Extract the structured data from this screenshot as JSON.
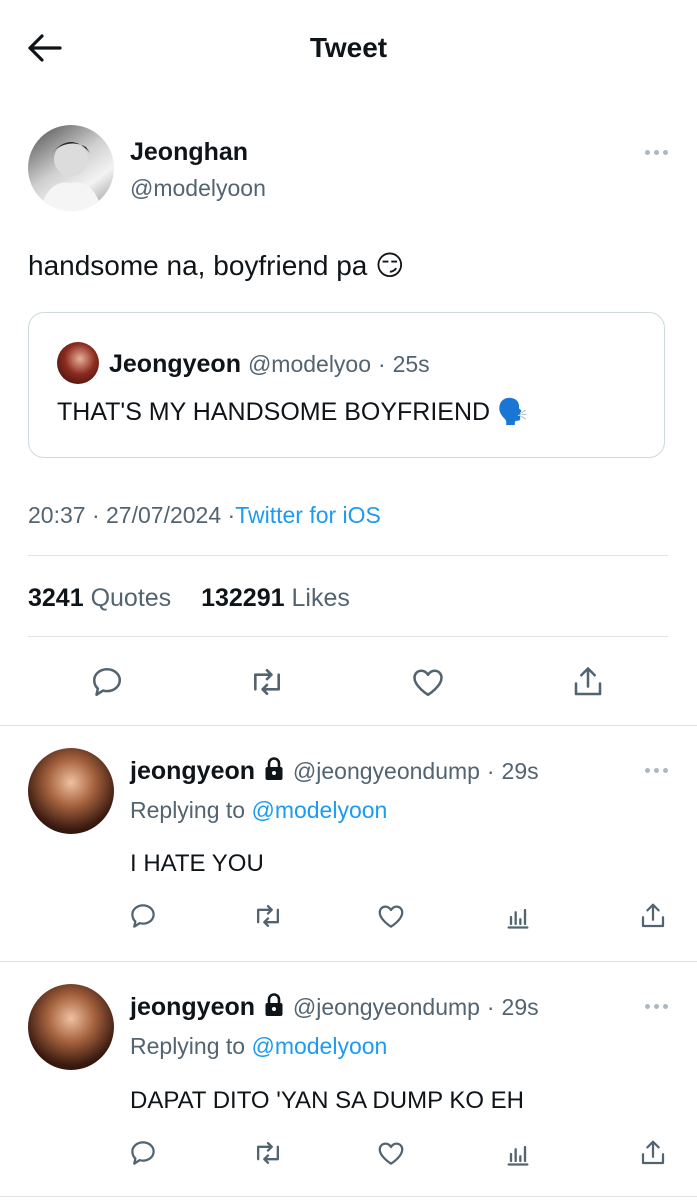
{
  "header": {
    "title": "Tweet",
    "back_icon": "arrow-left-icon"
  },
  "tweet": {
    "author_name": "Jeonghan",
    "author_handle": "@modelyoon",
    "text": "handsome na, boyfriend pa 😏",
    "quote": {
      "author_name": "Jeongyeon",
      "author_handle": "@modelyoo",
      "separator": "·",
      "time": "25s",
      "text": "THAT'S MY HANDSOME BOYFRIEND 🗣️"
    },
    "time": "20:37",
    "sep1": "·",
    "date": "27/07/2024",
    "sep2": "·",
    "source": "Twitter for iOS",
    "stats": {
      "quotes_count": "3241",
      "quotes_label": "Quotes",
      "likes_count": "132291",
      "likes_label": "Likes"
    }
  },
  "replies": [
    {
      "name": "jeongyeon",
      "handle": "@jeongyeondump",
      "separator": "·",
      "time": "29s",
      "replying_prefix": "Replying to",
      "replying_to": "@modelyoon",
      "text": "I HATE YOU"
    },
    {
      "name": "jeongyeon",
      "handle": "@jeongyeondump",
      "separator": "·",
      "time": "29s",
      "replying_prefix": "Replying to",
      "replying_to": "@modelyoon",
      "text": "DAPAT DITO 'YAN SA DUMP KO EH"
    }
  ],
  "colors": {
    "accent": "#1d9bf0",
    "secondary_text": "#536471",
    "divider": "#dfe3e6"
  }
}
